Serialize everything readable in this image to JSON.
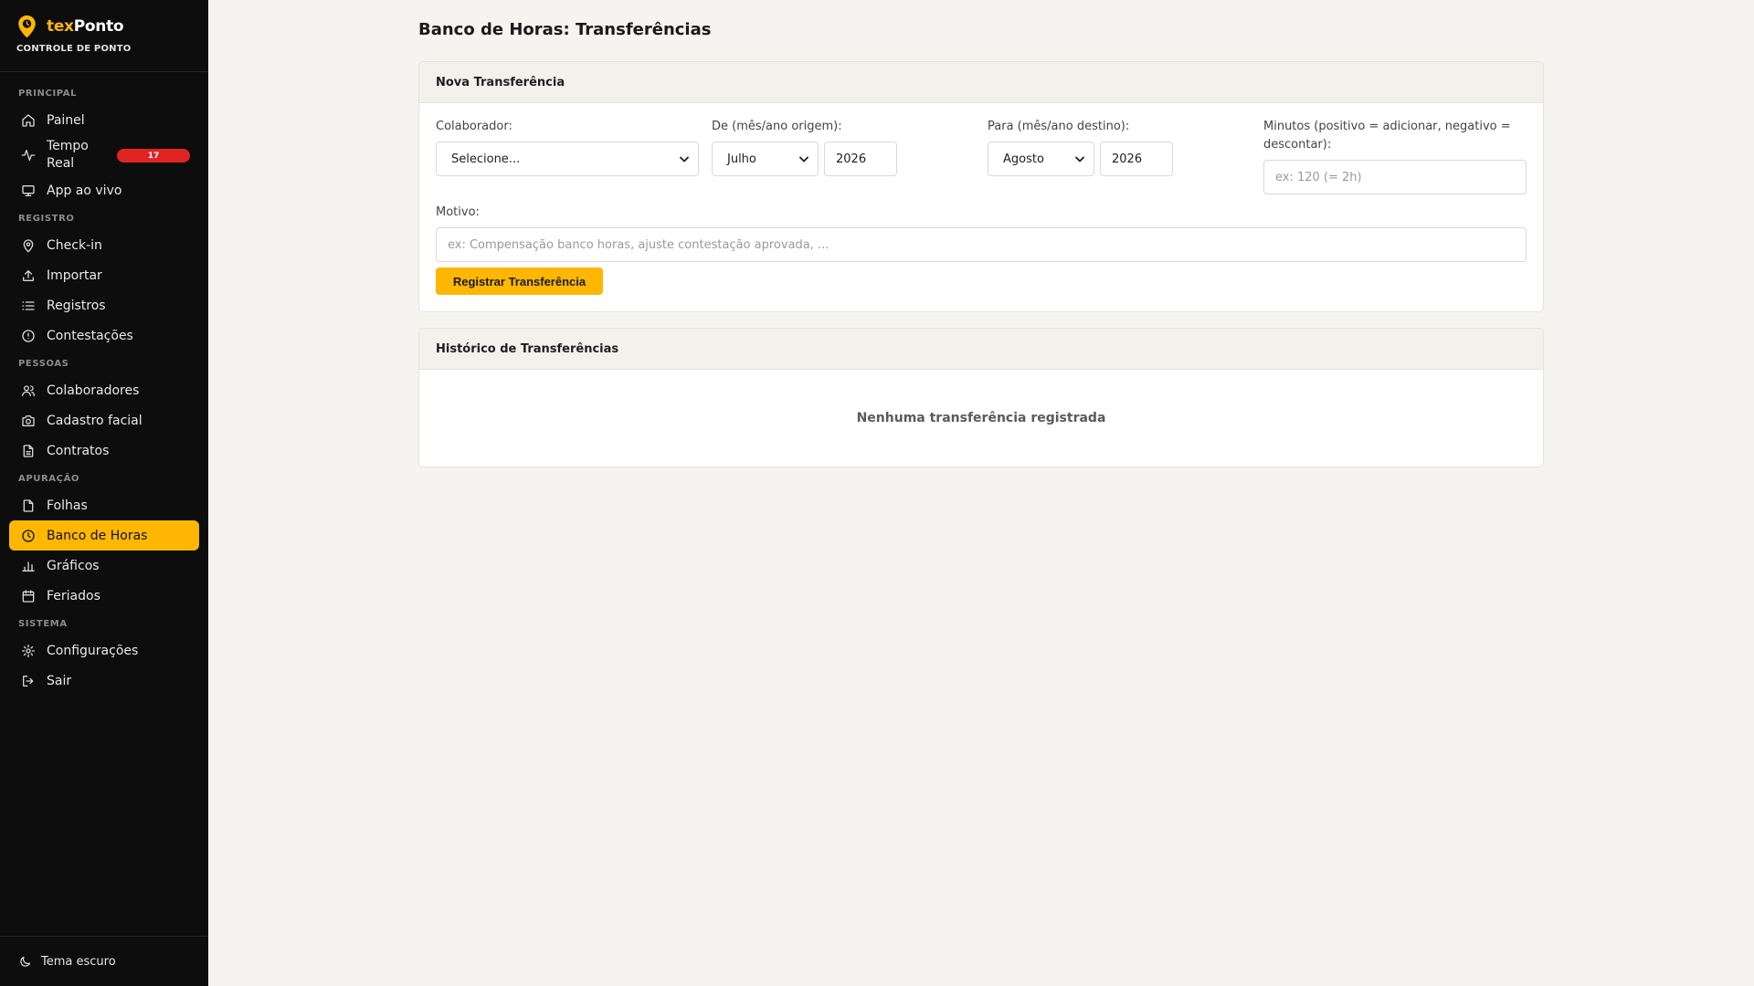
{
  "brand": {
    "name_prefix": "tex",
    "name_suffix": "Ponto",
    "subtitle": "CONTROLE DE PONTO"
  },
  "sidebar": {
    "sections": [
      {
        "title": "PRINCIPAL",
        "items": [
          {
            "label": "Painel",
            "icon": "home-icon"
          },
          {
            "label": "Tempo Real",
            "icon": "activity-icon",
            "badge": "17"
          },
          {
            "label": "App ao vivo",
            "icon": "monitor-icon"
          }
        ]
      },
      {
        "title": "REGISTRO",
        "items": [
          {
            "label": "Check-in",
            "icon": "map-pin-icon"
          },
          {
            "label": "Importar",
            "icon": "upload-icon"
          },
          {
            "label": "Registros",
            "icon": "list-icon"
          },
          {
            "label": "Contestações",
            "icon": "alert-circle-icon"
          }
        ]
      },
      {
        "title": "PESSOAS",
        "items": [
          {
            "label": "Colaboradores",
            "icon": "users-icon"
          },
          {
            "label": "Cadastro facial",
            "icon": "camera-icon"
          },
          {
            "label": "Contratos",
            "icon": "file-text-icon"
          }
        ]
      },
      {
        "title": "APURAÇÃO",
        "items": [
          {
            "label": "Folhas",
            "icon": "file-icon"
          },
          {
            "label": "Banco de Horas",
            "icon": "clock-icon",
            "active": true
          },
          {
            "label": "Gráficos",
            "icon": "bar-chart-icon"
          },
          {
            "label": "Feriados",
            "icon": "calendar-icon"
          }
        ]
      },
      {
        "title": "SISTEMA",
        "items": [
          {
            "label": "Configurações",
            "icon": "gear-icon"
          },
          {
            "label": "Sair",
            "icon": "logout-icon"
          }
        ]
      }
    ],
    "theme_toggle": "Tema escuro"
  },
  "page": {
    "title": "Banco de Horas: Transferências"
  },
  "form": {
    "title": "Nova Transferência",
    "colaborador": {
      "label": "Colaborador:",
      "value": "Selecione..."
    },
    "origem": {
      "label": "De (mês/ano origem):",
      "month": "Julho",
      "year": "2026"
    },
    "destino": {
      "label": "Para (mês/ano destino):",
      "month": "Agosto",
      "year": "2026"
    },
    "minutos": {
      "label": "Minutos (positivo = adicionar, negativo = descontar):",
      "placeholder": "ex: 120 (= 2h)"
    },
    "motivo": {
      "label": "Motivo:",
      "placeholder": "ex: Compensação banco horas, ajuste contestação aprovada, ..."
    },
    "submit_label": "Registrar Transferência"
  },
  "history": {
    "title": "Histórico de Transferências",
    "empty_text": "Nenhuma transferência registrada"
  },
  "colors": {
    "accent": "#ffb703",
    "sidebar_bg": "#0d0d0d",
    "badge": "#e02424",
    "page_bg": "#f5f4f0"
  }
}
